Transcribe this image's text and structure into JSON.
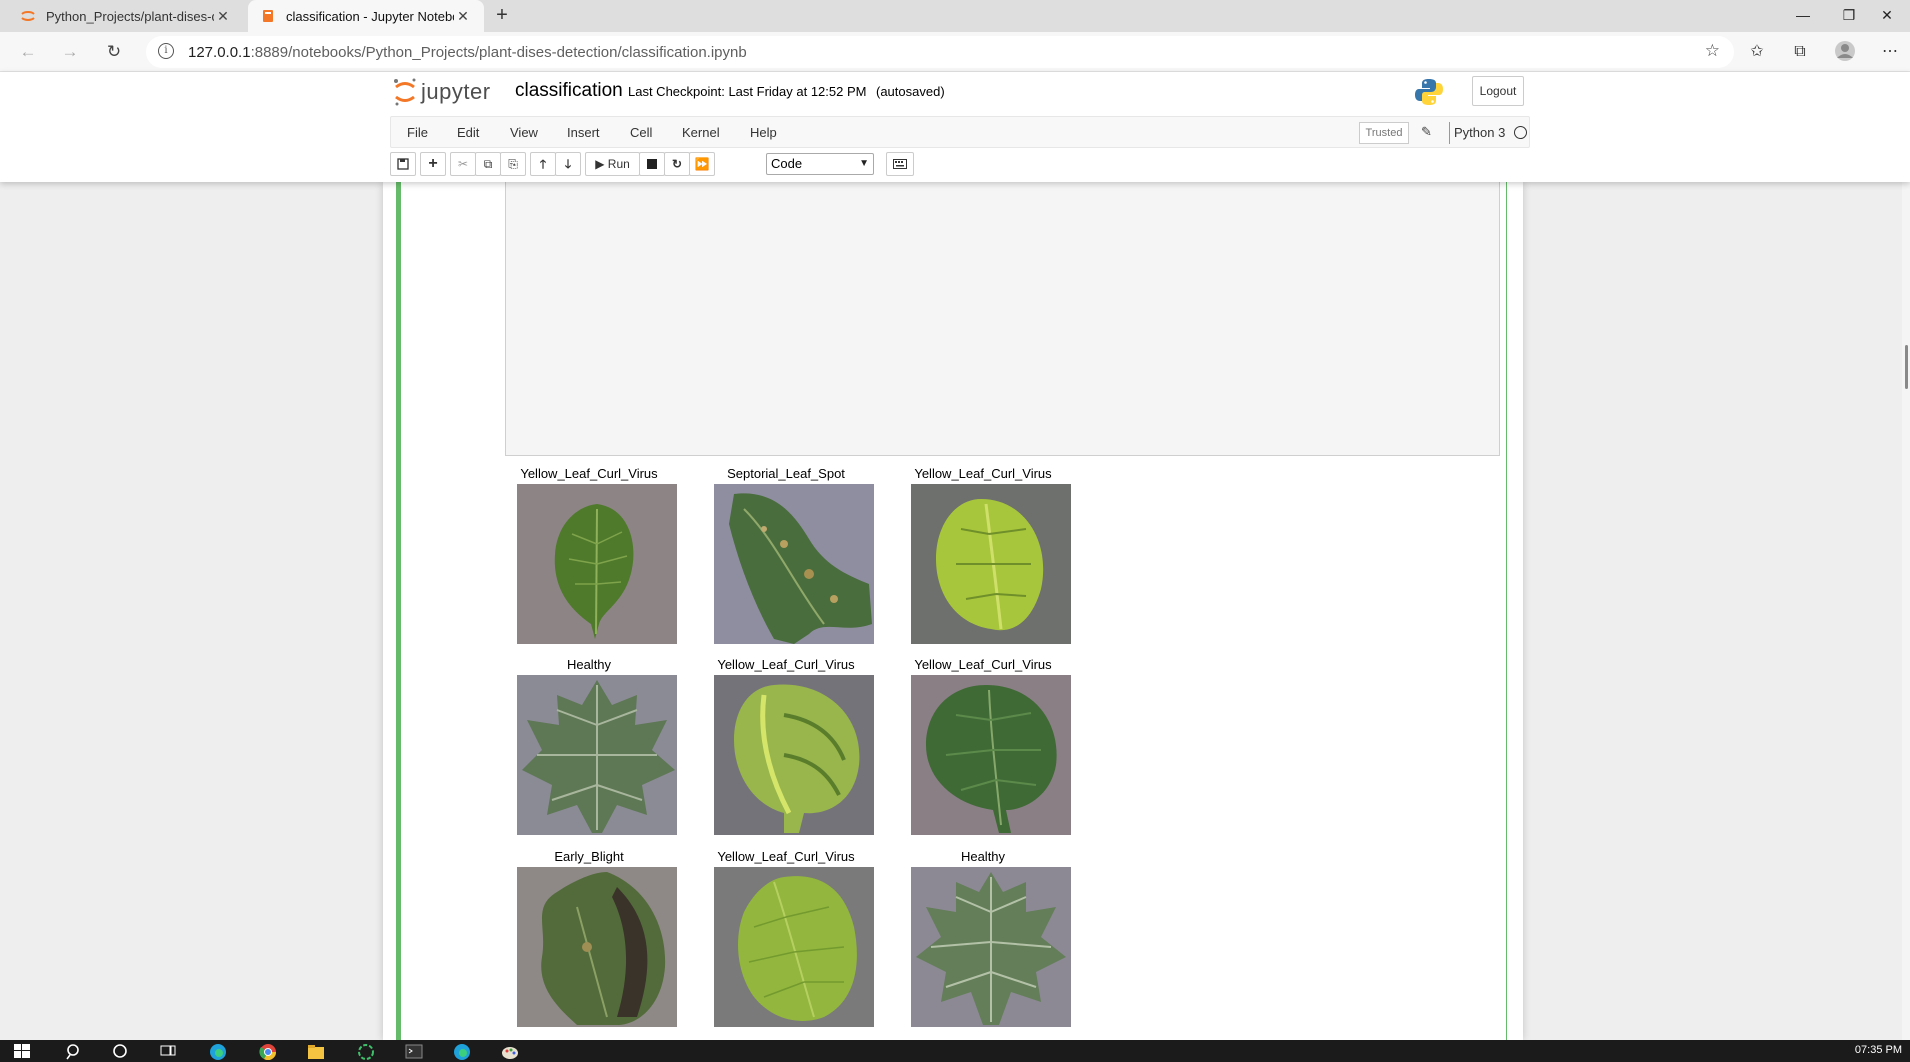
{
  "browser": {
    "tabs": [
      {
        "title": "Python_Projects/plant-dises-dete",
        "active": false,
        "favicon": "jupyter-icon"
      },
      {
        "title": "classification - Jupyter Notebook",
        "active": true,
        "favicon": "notebook-icon"
      }
    ],
    "url_host": "127.0.0.1",
    "url_path": ":8889/notebooks/Python_Projects/plant-dises-detection/classification.ipynb"
  },
  "jupyter": {
    "logo_text": "jupyter",
    "notebook_name": "classification",
    "checkpoint": "Last Checkpoint: Last Friday at 12:52 PM",
    "autosave": "(autosaved)",
    "logout_label": "Logout",
    "menu": [
      "File",
      "Edit",
      "View",
      "Insert",
      "Cell",
      "Kernel",
      "Help"
    ],
    "trusted_label": "Trusted",
    "kernel_name": "Python 3",
    "run_label": "Run",
    "cell_type": "Code"
  },
  "predictions": [
    {
      "label": "Yellow_Leaf_Curl_Virus"
    },
    {
      "label": "Septorial_Leaf_Spot"
    },
    {
      "label": "Yellow_Leaf_Curl_Virus"
    },
    {
      "label": "Healthy"
    },
    {
      "label": "Yellow_Leaf_Curl_Virus"
    },
    {
      "label": "Yellow_Leaf_Curl_Virus"
    },
    {
      "label": "Early_Blight"
    },
    {
      "label": "Yellow_Leaf_Curl_Virus"
    },
    {
      "label": "Healthy"
    }
  ],
  "taskbar": {
    "clock": "07:35 PM"
  },
  "colors": {
    "cell_selected": "#66bb6a",
    "jupyter_orange": "#f37726"
  }
}
